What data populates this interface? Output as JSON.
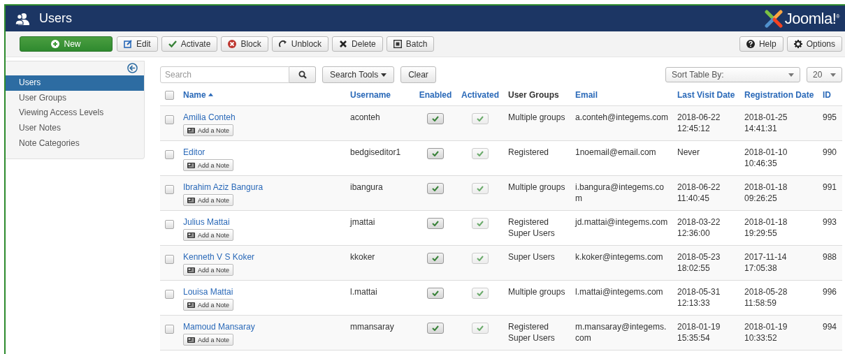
{
  "header": {
    "title": "Users",
    "logo": "Joomla!$^{®}$"
  },
  "toolbar": {
    "left": [
      {
        "label": "New",
        "primary": true
      },
      {
        "label": "Edit",
        "primary": false
      },
      {
        "label": "Activate",
        "primary": false
      },
      {
        "label": "Block",
        "primary": false
      },
      {
        "label": "Unblock",
        "primary": false
      },
      {
        "label": "Delete",
        "primary": false
      },
      {
        "label": "Batch",
        "primary": false
      }
    ],
    "right": [
      {
        "label": "Help"
      },
      {
        "label": "Options"
      }
    ]
  },
  "sidebar": {
    "items": [
      {
        "label": "Users",
        "selected": true
      },
      {
        "label": "User Groups",
        "selected": false
      },
      {
        "label": "Viewing Access Levels",
        "selected": false
      },
      {
        "label": "User Notes",
        "selected": false
      },
      {
        "label": "Note Categories",
        "selected": false
      }
    ]
  },
  "filters": {
    "search": {
      "placeholder": "Search"
    },
    "search_tools": "Search Tools",
    "clear": "Clear",
    "sort": "Sort Table By:",
    "limit": "20"
  },
  "table": {
    "select_all": {
      "checked": false
    },
    "columns": [
      {
        "label": "Name",
        "sortable": true,
        "sorted": true
      },
      {
        "label": "Username",
        "sortable": true,
        "sorted": false
      },
      {
        "label": "Enabled",
        "sortable": true,
        "sorted": false
      },
      {
        "label": "Activated",
        "sortable": true,
        "sorted": false
      },
      {
        "label": "User Groups",
        "sortable": false,
        "sorted": false
      },
      {
        "label": "Email",
        "sortable": true,
        "sorted": false
      },
      {
        "label": "Last Visit Date",
        "sortable": true,
        "sorted": false
      },
      {
        "label": "Registration Date",
        "sortable": true,
        "sorted": false
      },
      {
        "label": "ID",
        "sortable": true,
        "sorted": false
      }
    ],
    "rows": [
      {
        "checked": false,
        "name": "Amilia Conteh",
        "note": "Add a Note",
        "username": "aconteh",
        "enabled": true,
        "activated": true,
        "groups": [
          "Multiple groups"
        ],
        "email": "a.conteh@integems.com",
        "last_visit": "2018-06-22 12:45:12",
        "registered": "2018-01-25 14:41:31",
        "id": "995"
      },
      {
        "checked": false,
        "name": "Editor",
        "note": "Add a Note",
        "username": "bedgiseditor1",
        "enabled": true,
        "activated": true,
        "groups": [
          "Registered"
        ],
        "email": "1noemail@email.com",
        "last_visit": "Never",
        "registered": "2018-01-10 10:46:35",
        "id": "990"
      },
      {
        "checked": false,
        "name": "Ibrahim Aziz Bangura",
        "note": "Add a Note",
        "username": "ibangura",
        "enabled": true,
        "activated": true,
        "groups": [
          "Multiple groups"
        ],
        "email": "i.bangura@integems.com",
        "last_visit": "2018-06-22 11:40:45",
        "registered": "2018-01-18 09:26:25",
        "id": "991"
      },
      {
        "checked": false,
        "name": "Julius Mattai",
        "note": "Add a Note",
        "username": "jmattai",
        "enabled": true,
        "activated": true,
        "groups": [
          "Registered",
          "Super Users"
        ],
        "email": "jd.mattai@integems.com",
        "last_visit": "2018-03-22 12:36:00",
        "registered": "2018-01-18 19:29:55",
        "id": "993"
      },
      {
        "checked": false,
        "name": "Kenneth V S Koker",
        "note": "Add a Note",
        "username": "kkoker",
        "enabled": true,
        "activated": true,
        "groups": [
          "Super Users"
        ],
        "email": "k.koker@integems.com",
        "last_visit": "2018-05-23 18:02:55",
        "registered": "2017-11-14 17:05:38",
        "id": "988"
      },
      {
        "checked": false,
        "name": "Louisa Mattai",
        "note": "Add a Note",
        "username": "l.mattai",
        "enabled": true,
        "activated": true,
        "groups": [
          "Multiple groups"
        ],
        "email": "l.mattai@integems.com",
        "last_visit": "2018-05-31 12:13:33",
        "registered": "2018-05-28 11:58:59",
        "id": "996"
      },
      {
        "checked": false,
        "name": "Mamoud Mansaray",
        "note": "Add a Note",
        "username": "mmansaray",
        "enabled": true,
        "activated": true,
        "groups": [
          "Registered",
          "Super Users"
        ],
        "email": "m.mansaray@integems.com",
        "last_visit": "2018-01-19 15:35:54",
        "registered": "2018-01-19 10:33:52",
        "id": "994"
      }
    ]
  }
}
